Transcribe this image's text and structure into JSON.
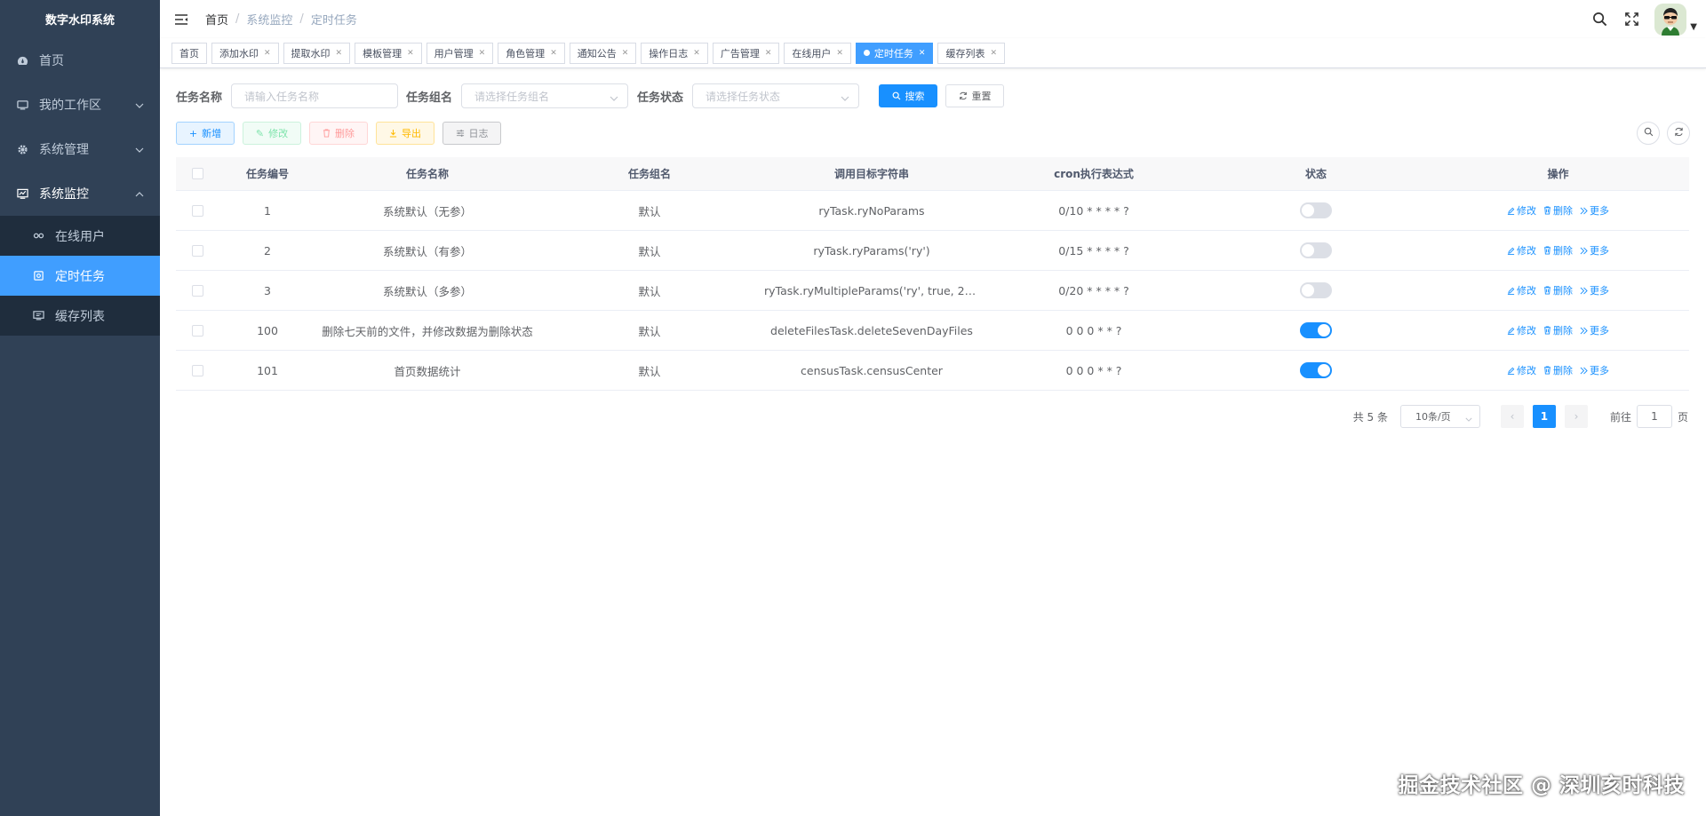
{
  "sidebar": {
    "logo": "数字水印系统",
    "items": [
      {
        "label": "首页"
      },
      {
        "label": "我的工作区"
      },
      {
        "label": "系统管理"
      },
      {
        "label": "系统监控"
      }
    ],
    "submenu": [
      {
        "label": "在线用户"
      },
      {
        "label": "定时任务"
      },
      {
        "label": "缓存列表"
      }
    ]
  },
  "breadcrumb": [
    "首页",
    "系统监控",
    "定时任务"
  ],
  "tags": [
    {
      "label": "首页"
    },
    {
      "label": "添加水印"
    },
    {
      "label": "提取水印"
    },
    {
      "label": "模板管理"
    },
    {
      "label": "用户管理"
    },
    {
      "label": "角色管理"
    },
    {
      "label": "通知公告"
    },
    {
      "label": "操作日志"
    },
    {
      "label": "广告管理"
    },
    {
      "label": "在线用户"
    },
    {
      "label": "定时任务"
    },
    {
      "label": "缓存列表"
    }
  ],
  "search": {
    "name_label": "任务名称",
    "name_placeholder": "请输入任务名称",
    "group_label": "任务组名",
    "group_placeholder": "请选择任务组名",
    "status_label": "任务状态",
    "status_placeholder": "请选择任务状态",
    "search_btn": "搜索",
    "reset_btn": "重置"
  },
  "toolbar": {
    "add": "新增",
    "edit": "修改",
    "delete": "删除",
    "export": "导出",
    "log": "日志"
  },
  "table": {
    "headers": [
      "任务编号",
      "任务名称",
      "任务组名",
      "调用目标字符串",
      "cron执行表达式",
      "状态",
      "操作"
    ],
    "rows": [
      {
        "id": "1",
        "name": "系统默认（无参）",
        "group": "默认",
        "target": "ryTask.ryNoParams",
        "cron": "0/10 * * * * ?",
        "enabled": false
      },
      {
        "id": "2",
        "name": "系统默认（有参）",
        "group": "默认",
        "target": "ryTask.ryParams('ry')",
        "cron": "0/15 * * * * ?",
        "enabled": false
      },
      {
        "id": "3",
        "name": "系统默认（多参）",
        "group": "默认",
        "target": "ryTask.ryMultipleParams('ry', true, 2000L...",
        "cron": "0/20 * * * * ?",
        "enabled": false
      },
      {
        "id": "100",
        "name": "删除七天前的文件，并修改数据为删除状态",
        "group": "默认",
        "target": "deleteFilesTask.deleteSevenDayFiles",
        "cron": "0 0 0 * * ?",
        "enabled": true
      },
      {
        "id": "101",
        "name": "首页数据统计",
        "group": "默认",
        "target": "censusTask.censusCenter",
        "cron": "0 0 0 * * ?",
        "enabled": true
      }
    ],
    "op_edit": "修改",
    "op_delete": "删除",
    "op_more": "更多"
  },
  "pagination": {
    "total": "共 5 条",
    "page_size": "10条/页",
    "current": "1",
    "goto_prefix": "前往",
    "goto_value": "1",
    "goto_suffix": "页"
  },
  "watermark": "掘金技术社区 @ 深圳亥时科技",
  "colors": {
    "primary": "#1890ff",
    "sidebar": "#304156",
    "submenu": "#1f2d3d"
  }
}
